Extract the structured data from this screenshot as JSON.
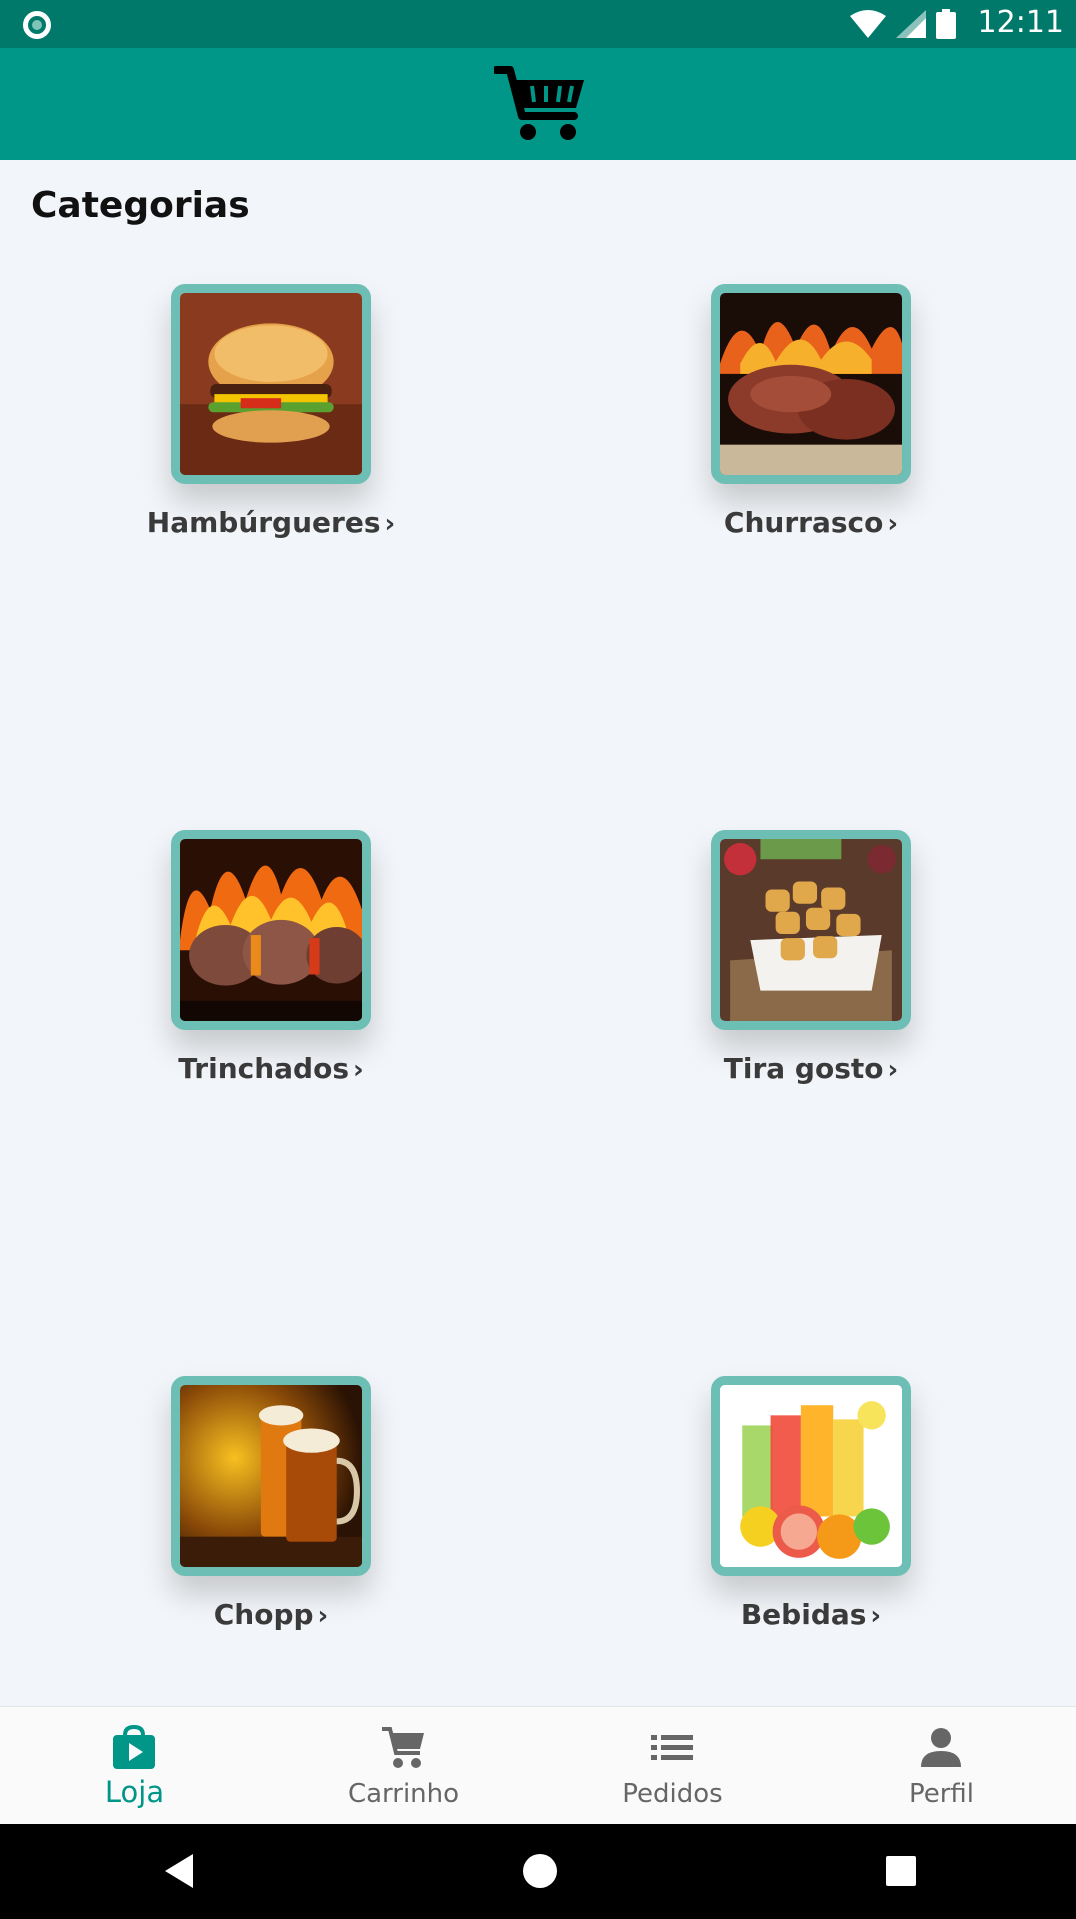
{
  "status_bar": {
    "time": "12:11"
  },
  "header": {
    "logo_icon": "shopping-cart-icon"
  },
  "section": {
    "title": "Categorias"
  },
  "categories": [
    {
      "label": "Hambúrgueres",
      "image": "burger-photo"
    },
    {
      "label": "Churrasco",
      "image": "grilled-meat-photo"
    },
    {
      "label": "Trinchados",
      "image": "meat-skewer-fire-photo"
    },
    {
      "label": "Tira gosto",
      "image": "fried-snacks-photo"
    },
    {
      "label": "Chopp",
      "image": "beer-mugs-photo"
    },
    {
      "label": "Bebidas",
      "image": "fruit-juices-photo"
    }
  ],
  "chevron": "›",
  "bottom_nav": {
    "items": [
      {
        "label": "Loja",
        "icon": "store-bag-icon",
        "active": true
      },
      {
        "label": "Carrinho",
        "icon": "cart-icon",
        "active": false
      },
      {
        "label": "Pedidos",
        "icon": "list-icon",
        "active": false
      },
      {
        "label": "Perfil",
        "icon": "person-icon",
        "active": false
      }
    ]
  },
  "colors": {
    "primary": "#009688",
    "status_bar": "#00796b",
    "frame": "#6dbfb5",
    "background": "#f2f5f9"
  }
}
